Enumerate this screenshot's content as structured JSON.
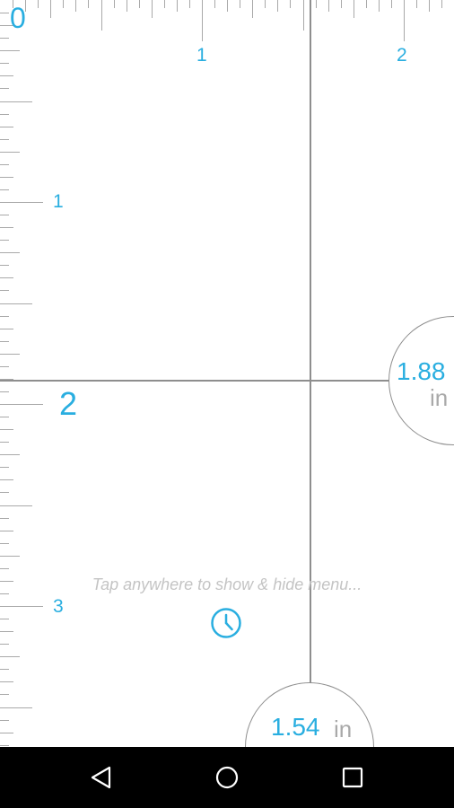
{
  "ruler": {
    "top_labels": [
      "0",
      "1",
      "2"
    ],
    "left_labels": [
      "1",
      "2",
      "3"
    ]
  },
  "measurements": {
    "horizontal": {
      "value": "1.88",
      "unit": "in"
    },
    "vertical": {
      "value": "1.54",
      "unit": "in"
    }
  },
  "hint": {
    "text": "Tap anywhere to show & hide menu..."
  },
  "icons": {
    "timer": "clock-icon",
    "back": "back-triangle-icon",
    "home": "home-circle-icon",
    "recents": "recents-square-icon"
  },
  "colors": {
    "accent": "#29aee0",
    "ticks": "#a9a9a9",
    "guide": "#8e8e8e",
    "hint": "#c4c4c4",
    "navbar": "#000000"
  }
}
